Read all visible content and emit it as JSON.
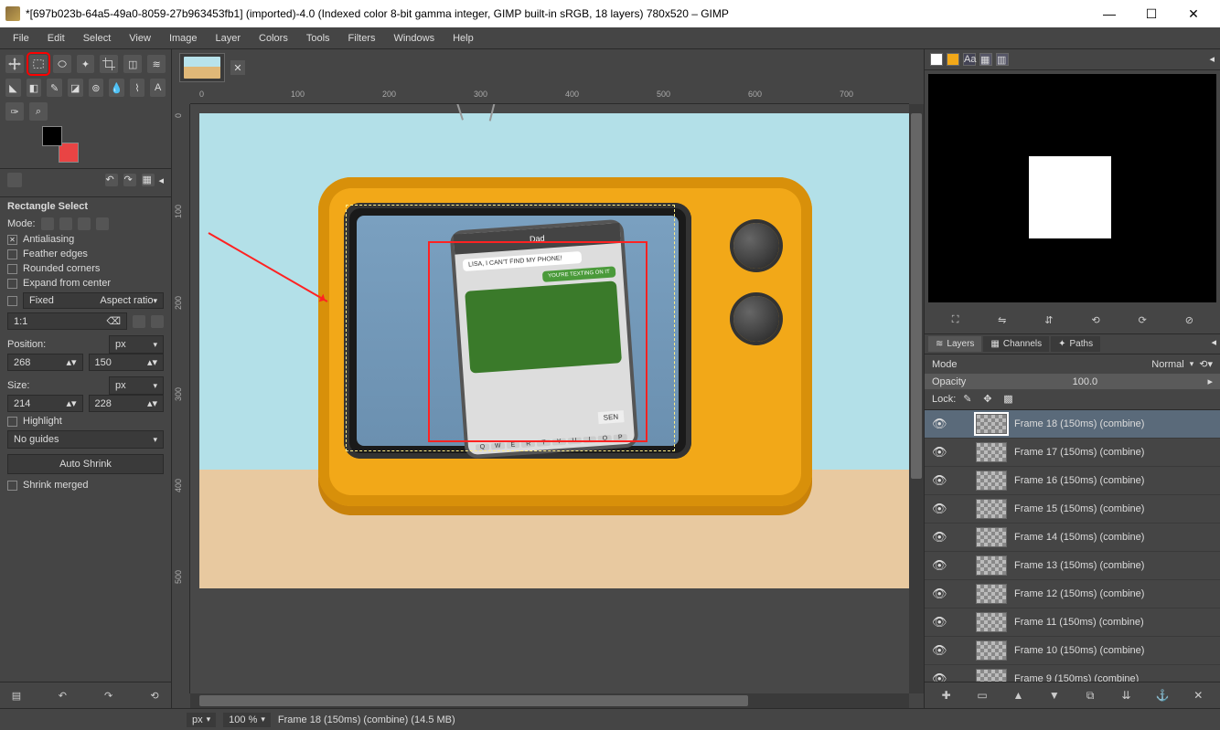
{
  "titlebar": {
    "title": "*[697b023b-64a5-49a0-8059-27b963453fb1] (imported)-4.0 (Indexed color 8-bit gamma integer, GIMP built-in sRGB, 18 layers) 780x520 – GIMP"
  },
  "menubar": [
    "File",
    "Edit",
    "Select",
    "View",
    "Image",
    "Layer",
    "Colors",
    "Tools",
    "Filters",
    "Windows",
    "Help"
  ],
  "rulers_h": [
    "0",
    "100",
    "200",
    "300",
    "400",
    "500",
    "600",
    "700"
  ],
  "rulers_v": [
    "0",
    "100",
    "200",
    "300",
    "400",
    "500"
  ],
  "tool_options": {
    "title": "Rectangle Select",
    "mode_label": "Mode:",
    "antialiasing": "Antialiasing",
    "feather": "Feather edges",
    "rounded": "Rounded corners",
    "expand": "Expand from center",
    "fixed": "Fixed",
    "fixed_value": "Aspect ratio",
    "ratio": "1:1",
    "position_label": "Position:",
    "pos_unit": "px",
    "pos_x": "268",
    "pos_y": "150",
    "size_label": "Size:",
    "size_unit": "px",
    "size_w": "214",
    "size_h": "228",
    "highlight": "Highlight",
    "guides": "No guides",
    "auto_shrink": "Auto Shrink",
    "shrink_merged": "Shrink merged"
  },
  "right_tabs": {
    "layers": "Layers",
    "channels": "Channels",
    "paths": "Paths"
  },
  "layer_panel": {
    "mode_label": "Mode",
    "mode_value": "Normal",
    "opacity_label": "Opacity",
    "opacity_value": "100.0",
    "lock_label": "Lock:"
  },
  "layers": [
    {
      "name": "Frame 18 (150ms) (combine)",
      "active": true
    },
    {
      "name": "Frame 17 (150ms) (combine)"
    },
    {
      "name": "Frame 16 (150ms) (combine)"
    },
    {
      "name": "Frame 15 (150ms) (combine)"
    },
    {
      "name": "Frame 14 (150ms) (combine)"
    },
    {
      "name": "Frame 13 (150ms) (combine)"
    },
    {
      "name": "Frame 12 (150ms) (combine)"
    },
    {
      "name": "Frame 11 (150ms) (combine)"
    },
    {
      "name": "Frame 10 (150ms) (combine)"
    },
    {
      "name": "Frame 9 (150ms) (combine)"
    }
  ],
  "statusbar": {
    "unit": "px",
    "zoom": "100 %",
    "info": "Frame 18 (150ms) (combine) (14.5 MB)"
  },
  "phone": {
    "title": "Dad",
    "msg1": "LISA, I CAN'T FIND MY PHONE!",
    "msg2": "YOU'RE TEXTING ON IT",
    "send": "SEN",
    "keys": [
      "Q",
      "W",
      "E",
      "R",
      "T",
      "Y",
      "U",
      "I",
      "O",
      "P"
    ]
  }
}
